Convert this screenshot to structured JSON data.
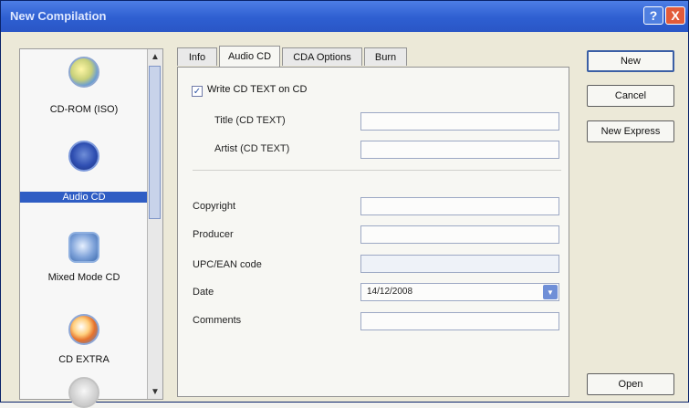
{
  "window": {
    "title": "New Compilation"
  },
  "titlebar": {
    "help_label": "?",
    "close_label": "X"
  },
  "compilation_list": {
    "items": [
      {
        "label": "CD-ROM (ISO)",
        "icon": "cd-rom-iso-icon"
      },
      {
        "label": "Audio CD",
        "icon": "audio-cd-icon",
        "selected": true
      },
      {
        "label": "Mixed Mode CD",
        "icon": "mixed-mode-cd-icon"
      },
      {
        "label": "CD EXTRA",
        "icon": "cd-extra-icon"
      }
    ]
  },
  "tabs": [
    {
      "label": "Info"
    },
    {
      "label": "Audio CD",
      "active": true
    },
    {
      "label": "CDA Options"
    },
    {
      "label": "Burn"
    }
  ],
  "audio_cd": {
    "write_cd_text_label": "Write CD TEXT on CD",
    "write_cd_text_checked": true,
    "title_label": "Title (CD TEXT)",
    "artist_label": "Artist (CD TEXT)",
    "copyright_label": "Copyright",
    "producer_label": "Producer",
    "upc_label": "UPC/EAN code",
    "date_label": "Date",
    "date_value": "14/12/2008",
    "comments_label": "Comments"
  },
  "buttons": {
    "new": "New",
    "cancel": "Cancel",
    "new_express": "New Express",
    "open": "Open"
  },
  "colors": {
    "titlebar": "#2e5fd1",
    "selection": "#2f5dc4",
    "close_button": "#e25b3a"
  }
}
